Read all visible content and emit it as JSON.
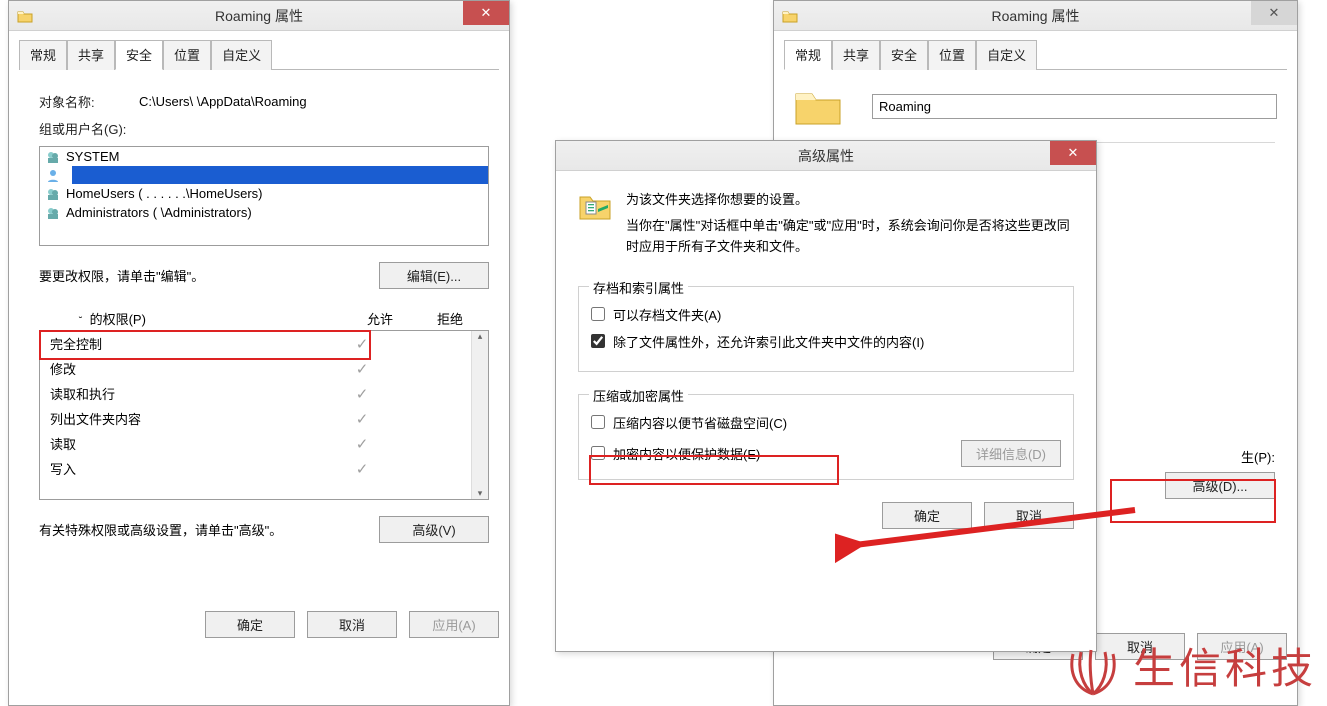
{
  "win1": {
    "title": "Roaming 属性",
    "tabs": [
      "常规",
      "共享",
      "安全",
      "位置",
      "自定义"
    ],
    "object_label": "对象名称:",
    "object_path": "C:\\Users\\             \\AppData\\Roaming",
    "groups_label": "组或用户名(G):",
    "users": [
      {
        "name": "SYSTEM",
        "type": "group"
      },
      {
        "name": "",
        "type": "user",
        "selected": true
      },
      {
        "name": "HomeUsers ( . . .  . . .\\HomeUsers)",
        "type": "group"
      },
      {
        "name": "Administrators (               \\Administrators)",
        "type": "group"
      }
    ],
    "edit_hint": "要更改权限，请单击\"编辑\"。",
    "edit_btn": "编辑(E)...",
    "perm_header_prefix": "的权限(P)",
    "perm_allow": "允许",
    "perm_deny": "拒绝",
    "perms": [
      {
        "name": "完全控制",
        "allow": true
      },
      {
        "name": "修改",
        "allow": true
      },
      {
        "name": "读取和执行",
        "allow": true
      },
      {
        "name": "列出文件夹内容",
        "allow": true
      },
      {
        "name": "读取",
        "allow": true
      },
      {
        "name": "写入",
        "allow": true
      }
    ],
    "adv_hint": "有关特殊权限或高级设置，请单击\"高级\"。",
    "adv_btn": "高级(V)",
    "ok": "确定",
    "cancel": "取消",
    "apply": "应用(A)"
  },
  "win2": {
    "title": "Roaming 属性",
    "tabs": [
      "常规",
      "共享",
      "安全",
      "位置",
      "自定义"
    ],
    "name_value": "Roaming",
    "attrs_label": "生(P):",
    "adv_btn": "高级(D)...",
    "ok": "确定",
    "cancel": "取消",
    "apply": "应用(A)"
  },
  "dlg": {
    "title": "高级属性",
    "head1": "为该文件夹选择你想要的设置。",
    "head2": "当你在\"属性\"对话框中单击\"确定\"或\"应用\"时，系统会询问你是否将这些更改同时应用于所有子文件夹和文件。",
    "group1_title": "存档和索引属性",
    "cb_archive": "可以存档文件夹(A)",
    "cb_index": "除了文件属性外，还允许索引此文件夹中文件的内容(I)",
    "group2_title": "压缩或加密属性",
    "cb_compress": "压缩内容以便节省磁盘空间(C)",
    "cb_encrypt": "加密内容以便保护数据(E)",
    "details_btn": "详细信息(D)",
    "ok": "确定",
    "cancel": "取消"
  },
  "watermark_text": "生信科技"
}
